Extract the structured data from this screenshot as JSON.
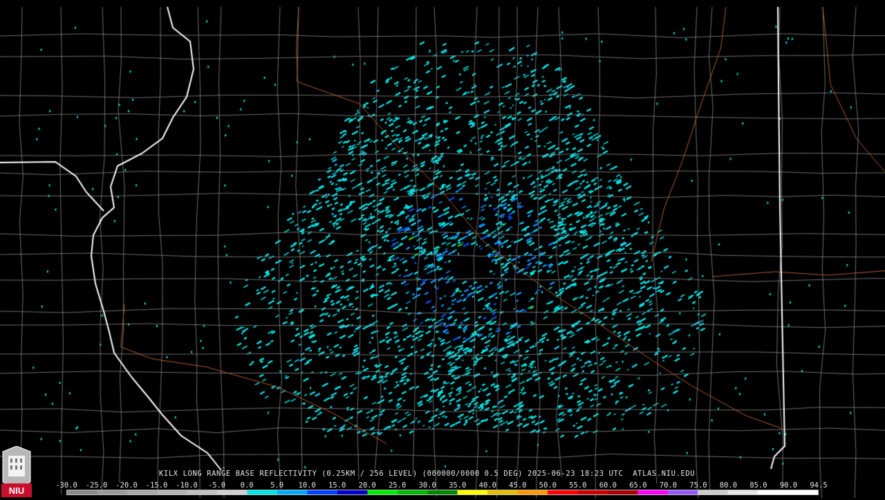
{
  "product": {
    "caption": "KILX LONG RANGE BASE REFLECTIVITY (0.25KM / 256 LEVEL) (000000/0000 0.5 DEG) 2025-06-23 18:23 UTC  ATLAS.NIU.EDU"
  },
  "logo": {
    "text": "NIU"
  },
  "scale": {
    "labels": [
      "-30.0",
      "-25.0",
      "-20.0",
      "-15.0",
      "-10.0",
      "-5.0",
      "0.0",
      "5.0",
      "10.0",
      "15.0",
      "20.0",
      "25.0",
      "30.0",
      "35.0",
      "40.0",
      "45.0",
      "50.0",
      "55.0",
      "60.0",
      "65.0",
      "70.0",
      "75.0",
      "80.0",
      "85.0",
      "90.0",
      "94.5"
    ],
    "colors": [
      "#8a8a8a",
      "#9a9a9a",
      "#a8a8a8",
      "#b4b4b4",
      "#c2c2c2",
      "#d0d0d0",
      "#00e6e6",
      "#00aaff",
      "#0044ff",
      "#0000cc",
      "#00ee00",
      "#00bb00",
      "#008800",
      "#ffff00",
      "#e6c000",
      "#ff9900",
      "#ff0000",
      "#cc0000",
      "#aa0000",
      "#ff00ff",
      "#9955ff",
      "#cccccc",
      "#e6e6e6",
      "#ffffff",
      "#ffffff"
    ]
  },
  "map": {
    "background": "#000000",
    "county_line_color": "#8a8a8a",
    "state_line_color": "#ffffff",
    "river_color": "#b45a2a",
    "echo_colors": [
      "#00e6e6",
      "#1fc8e6",
      "#1090ff",
      "#0050ff",
      "#22cc22"
    ]
  }
}
